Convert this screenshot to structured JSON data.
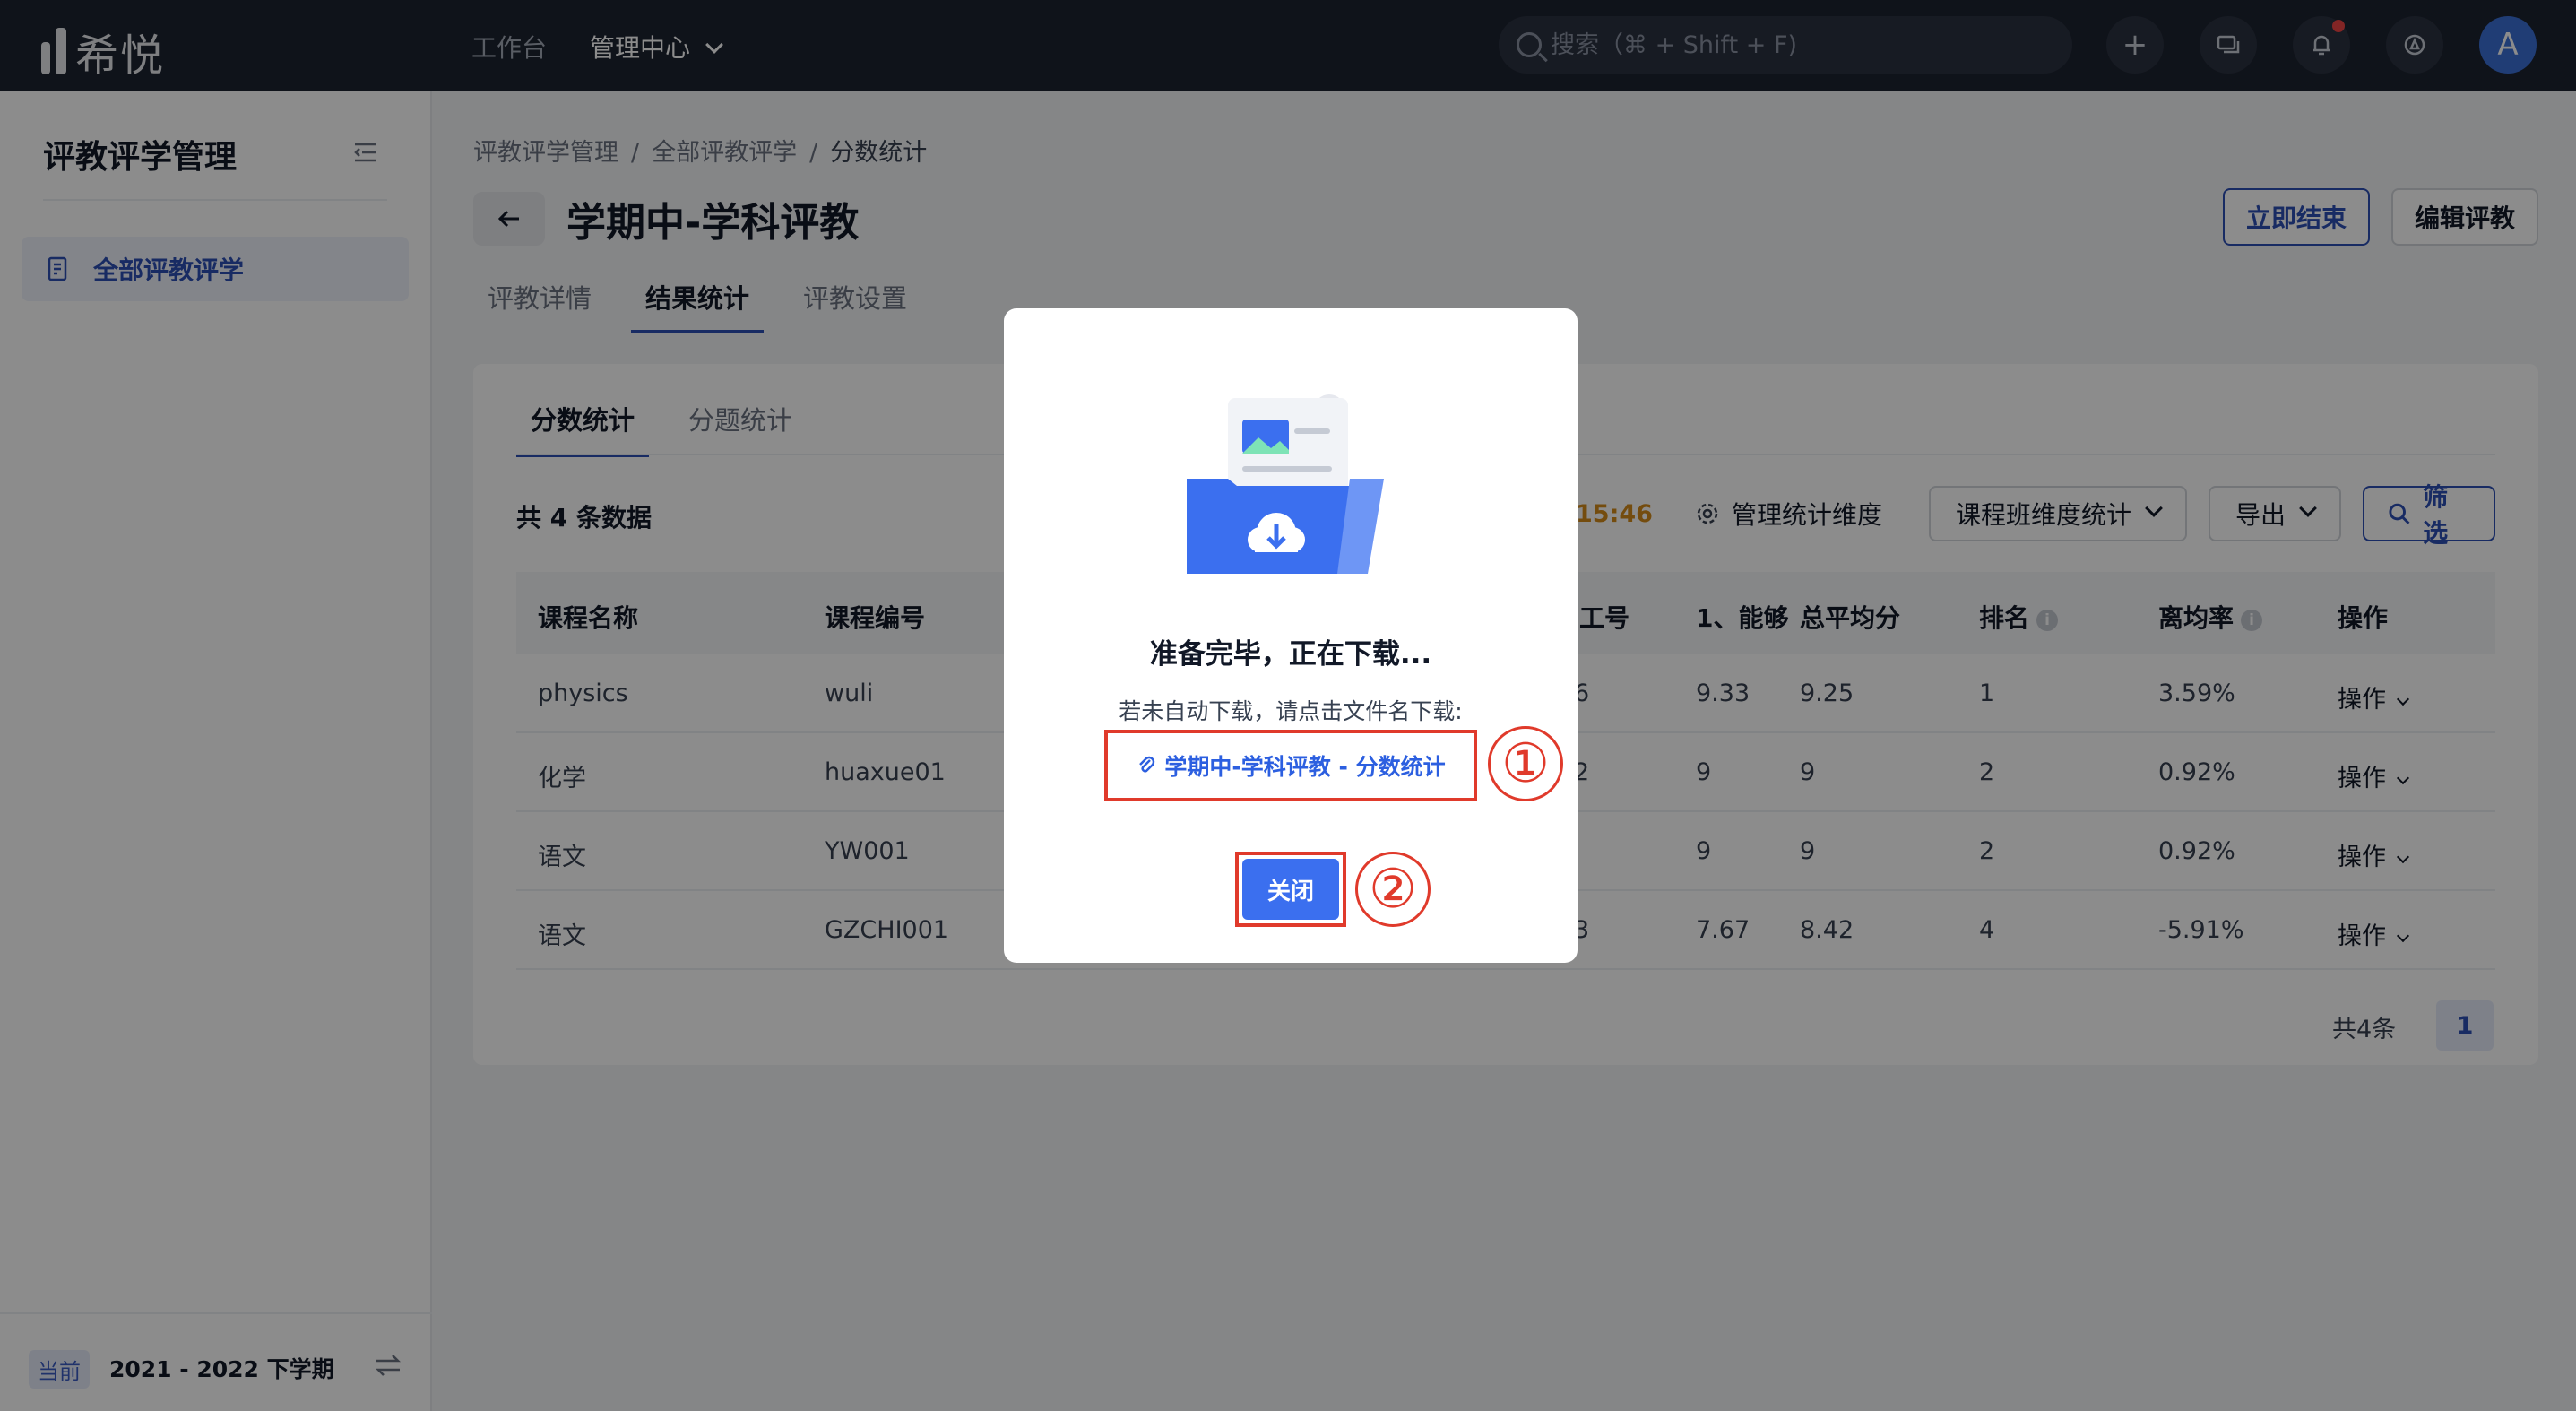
{
  "app": {
    "name": "希悦"
  },
  "topnav": {
    "workbench": "工作台",
    "admin": "管理中心",
    "search_placeholder": "搜索（⌘ + Shift + F)",
    "avatar": "A"
  },
  "sidebar": {
    "title": "评教评学管理",
    "items": [
      {
        "label": "全部评教评学"
      }
    ],
    "term_badge": "当前",
    "term": "2021 - 2022 下学期"
  },
  "breadcrumb": [
    "评教评学管理",
    "全部评教评学",
    "分数统计"
  ],
  "page": {
    "title": "学期中-学科评教",
    "end_now": "立即结束",
    "edit": "编辑评教"
  },
  "tabs": [
    "评教详情",
    "结果统计",
    "评教设置"
  ],
  "subtabs": [
    "分数统计",
    "分题统计"
  ],
  "toolbar": {
    "count": "共 4 条数据",
    "time": "15:46",
    "manage_dims": "管理统计维度",
    "dim_select": "课程班维度统计",
    "export": "导出",
    "filter": "筛选"
  },
  "table": {
    "headers": [
      "课程名称",
      "课程编号",
      "工号",
      "1、能够",
      "总平均分",
      "排名",
      "离均率",
      "操作"
    ],
    "rows": [
      {
        "name": "physics",
        "code": "wuli",
        "emp": "6",
        "q1": "9.33",
        "avg": "9.25",
        "rank": "1",
        "dev": "3.59%",
        "op": "操作"
      },
      {
        "name": "化学",
        "code": "huaxue01",
        "emp": "2",
        "q1": "9",
        "avg": "9",
        "rank": "2",
        "dev": "0.92%",
        "op": "操作"
      },
      {
        "name": "语文",
        "code": "YW001",
        "emp": "",
        "q1": "9",
        "avg": "9",
        "rank": "2",
        "dev": "0.92%",
        "op": "操作"
      },
      {
        "name": "语文",
        "code": "GZCHI001",
        "emp": "3",
        "q1": "7.67",
        "avg": "8.42",
        "rank": "4",
        "dev": "-5.91%",
        "op": "操作"
      }
    ]
  },
  "pager": {
    "total": "共4条",
    "page": "1"
  },
  "modal": {
    "title": "准备完毕，正在下载...",
    "hint": "若未自动下载，请点击文件名下载:",
    "file_name": "学期中-学科评教 - 分数统计",
    "close": "关闭",
    "marker1": "①",
    "marker2": "②"
  },
  "colors": {
    "primary": "#2c4fb4",
    "highlight": "#e03a2b",
    "topbar": "#1d2330"
  }
}
